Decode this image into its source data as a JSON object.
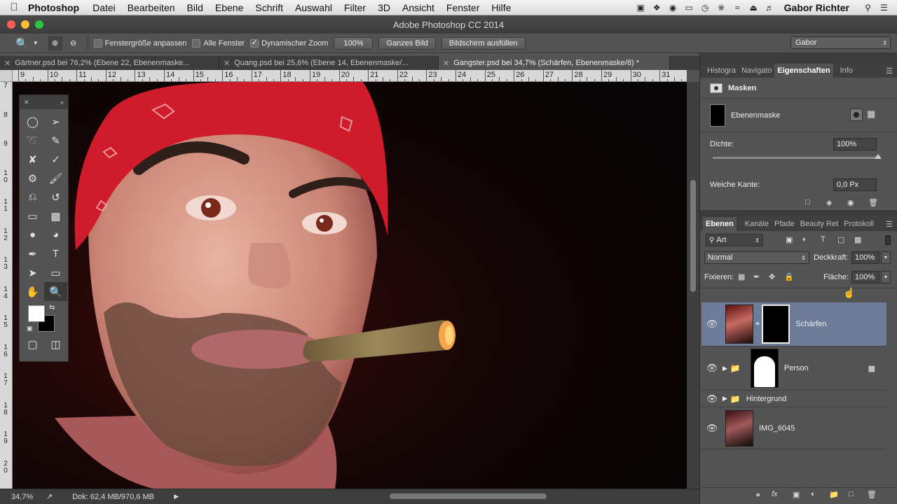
{
  "menubar": {
    "app_name": "Photoshop",
    "items": [
      "Datei",
      "Bearbeiten",
      "Bild",
      "Ebene",
      "Schrift",
      "Auswahl",
      "Filter",
      "3D",
      "Ansicht",
      "Fenster",
      "Hilfe"
    ],
    "user": "Gabor Richter"
  },
  "window": {
    "title": "Adobe Photoshop CC 2014"
  },
  "options": {
    "check_fit": "Fenstergröße anpassen",
    "check_all": "Alle Fenster",
    "check_dynamic": "Dynamischer Zoom",
    "zoom_button": "100%",
    "fit_button": "Ganzes Bild",
    "fill_button": "Bildschirm ausfüllen",
    "workspace": "Gabor"
  },
  "tabs": [
    {
      "label": "Gärtner.psd bei 76,2% (Ebene 22, Ebenenmaske..."
    },
    {
      "label": "Quang.psd bei 25,6% (Ebene 14, Ebenenmaske/..."
    },
    {
      "label": "Gangster.psd bei 34,7% (Schärfen, Ebenenmaske/8) *"
    }
  ],
  "ruler": {
    "h_labels": [
      "9",
      "10",
      "11",
      "12",
      "13",
      "14",
      "15",
      "16",
      "17",
      "18",
      "19",
      "20",
      "21",
      "22",
      "23",
      "24",
      "25",
      "26",
      "27",
      "28",
      "29",
      "30",
      "31",
      "32"
    ],
    "v_labels": [
      "7",
      "8",
      "9",
      "10",
      "11",
      "12",
      "13",
      "14",
      "15",
      "16",
      "17",
      "18",
      "19",
      "20"
    ]
  },
  "status": {
    "zoom": "34,7%",
    "doc": "Dok: 62,4 MB/970,6 MB"
  },
  "properties": {
    "tabs": [
      "Histogra",
      "Navigato",
      "Eigenschaften",
      "Info"
    ],
    "section": "Masken",
    "mask_name": "Ebenenmaske",
    "density_label": "Dichte:",
    "density_value": "100%",
    "density_fraction": 1.0,
    "feather_label": "Weiche Kante:",
    "feather_value": "0,0 Px"
  },
  "layers_panel": {
    "tabs": [
      "Ebenen",
      "Kanäle",
      "Pfade",
      "Beauty Ret",
      "Protokoll"
    ],
    "filter": "Art",
    "blend_mode": "Normal",
    "opacity_label": "Deckkraft:",
    "opacity_value": "100%",
    "lock_label": "Fixieren:",
    "fill_label": "Fläche:",
    "fill_value": "100%",
    "layers": [
      {
        "name": "Schärfen"
      },
      {
        "name": "Person"
      },
      {
        "name": "Hintergrund"
      },
      {
        "name": "IMG_6045"
      }
    ]
  }
}
